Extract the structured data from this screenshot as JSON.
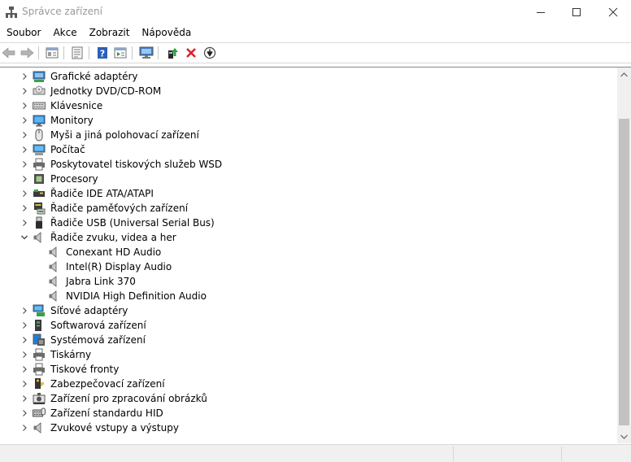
{
  "window": {
    "title": "Správce zařízení"
  },
  "menu": [
    "Soubor",
    "Akce",
    "Zobrazit",
    "Nápověda"
  ],
  "toolbar": {
    "buttons": [
      "back-arrow-icon",
      "forward-arrow-icon",
      "show-hide-tree-icon",
      "properties-icon",
      "help-icon",
      "run-action-icon",
      "monitor-scan-icon",
      "update-driver-icon",
      "uninstall-icon",
      "disable-device-icon"
    ]
  },
  "tree": {
    "items": [
      {
        "label": "Grafické adaptéry",
        "icon": "display-adapter-icon",
        "expanded": false,
        "level": 0
      },
      {
        "label": "Jednotky DVD/CD-ROM",
        "icon": "dvd-drive-icon",
        "expanded": false,
        "level": 0
      },
      {
        "label": "Klávesnice",
        "icon": "keyboard-icon",
        "expanded": false,
        "level": 0
      },
      {
        "label": "Monitory",
        "icon": "monitor-icon",
        "expanded": false,
        "level": 0
      },
      {
        "label": "Myši a jiná polohovací zařízení",
        "icon": "mouse-icon",
        "expanded": false,
        "level": 0
      },
      {
        "label": "Počítač",
        "icon": "computer-icon",
        "expanded": false,
        "level": 0
      },
      {
        "label": "Poskytovatel tiskových služeb WSD",
        "icon": "printer-icon",
        "expanded": false,
        "level": 0
      },
      {
        "label": "Procesory",
        "icon": "processor-icon",
        "expanded": false,
        "level": 0
      },
      {
        "label": "Řadiče IDE ATA/ATAPI",
        "icon": "ide-controller-icon",
        "expanded": false,
        "level": 0
      },
      {
        "label": "Řadiče paměťových zařízení",
        "icon": "storage-controller-icon",
        "expanded": false,
        "level": 0
      },
      {
        "label": "Řadiče USB (Universal Serial Bus)",
        "icon": "usb-icon",
        "expanded": false,
        "level": 0
      },
      {
        "label": "Řadiče zvuku, videa a her",
        "icon": "speaker-icon",
        "expanded": true,
        "level": 0
      },
      {
        "label": "Conexant HD Audio",
        "icon": "speaker-icon",
        "level": 1
      },
      {
        "label": "Intel(R) Display Audio",
        "icon": "speaker-icon",
        "level": 1
      },
      {
        "label": "Jabra Link 370",
        "icon": "speaker-icon",
        "level": 1
      },
      {
        "label": "NVIDIA High Definition Audio",
        "icon": "speaker-icon",
        "level": 1
      },
      {
        "label": "Síťové adaptéry",
        "icon": "network-adapter-icon",
        "expanded": false,
        "level": 0
      },
      {
        "label": "Softwarová zařízení",
        "icon": "software-device-icon",
        "expanded": false,
        "level": 0
      },
      {
        "label": "Systémová zařízení",
        "icon": "system-device-icon",
        "expanded": false,
        "level": 0
      },
      {
        "label": "Tiskárny",
        "icon": "printer-icon",
        "expanded": false,
        "level": 0
      },
      {
        "label": "Tiskové fronty",
        "icon": "printer-icon",
        "expanded": false,
        "level": 0
      },
      {
        "label": "Zabezpečovací zařízení",
        "icon": "security-device-icon",
        "expanded": false,
        "level": 0
      },
      {
        "label": "Zařízení pro zpracování obrázků",
        "icon": "camera-icon",
        "expanded": false,
        "level": 0
      },
      {
        "label": "Zařízení standardu HID",
        "icon": "hid-icon",
        "expanded": false,
        "level": 0
      },
      {
        "label": "Zvukové vstupy a výstupy",
        "icon": "speaker-icon",
        "expanded": false,
        "level": 0
      }
    ]
  },
  "colors": {
    "accent": "#1e6fd9",
    "scroll_thumb": "#c2c2c2",
    "status_bg": "#f0f0f0"
  }
}
